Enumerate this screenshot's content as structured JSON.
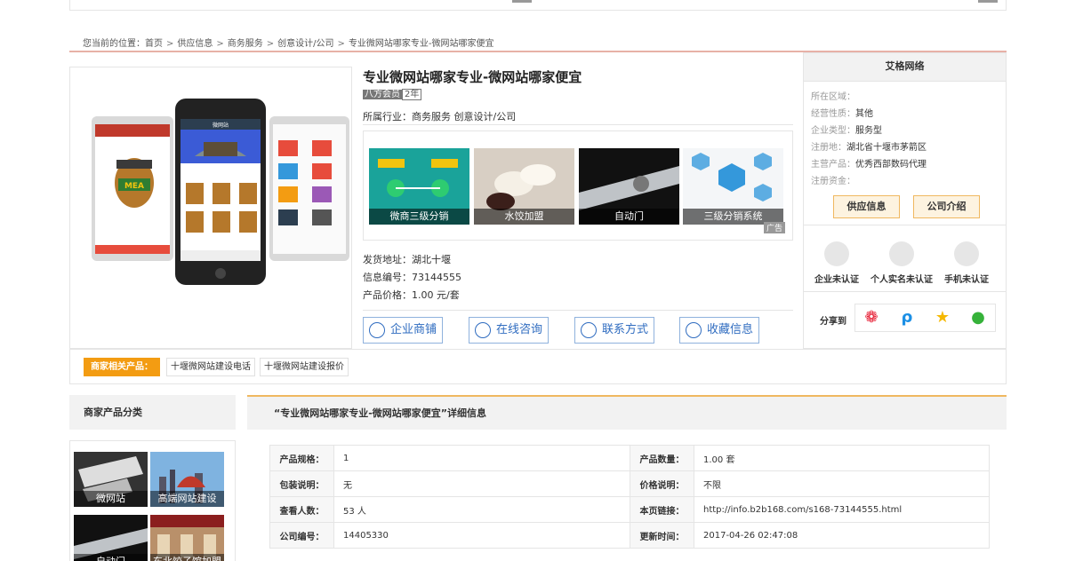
{
  "breadcrumb": {
    "prefix": "您当前的位置：",
    "items": [
      "首页",
      "供应信息",
      "商务服务",
      "创意设计/公司",
      "专业微网站哪家专业-微网站哪家便宜"
    ]
  },
  "product": {
    "title": "专业微网站哪家专业-微网站哪家便宜",
    "member_label": "八方会员",
    "member_years": "2年",
    "industry": "所属行业：商务服务 创意设计/公司",
    "ads": [
      "微商三级分销",
      "水饺加盟",
      "自动门",
      "三级分销系统"
    ],
    "ad_tag": "广告",
    "ship_from": "发货地址：湖北十堰",
    "info_id": "信息编号：73144555",
    "price": "产品价格：1.00 元/套",
    "actions": [
      "企业商铺",
      "在线咨询",
      "联系方式",
      "收藏信息"
    ],
    "phone_mock": {
      "jar_label": "MEA",
      "center_header": "微网站"
    }
  },
  "seller": {
    "name": "艾格网络",
    "rows": [
      {
        "label": "所在区域：",
        "value": ""
      },
      {
        "label": "经营性质：",
        "value": "其他"
      },
      {
        "label": "企业类型：",
        "value": "服务型"
      },
      {
        "label": "注册地：",
        "value": "湖北省十堰市茅箭区"
      },
      {
        "label": "主营产品：",
        "value": "优秀西部数码代理"
      },
      {
        "label": "注册资金：",
        "value": ""
      }
    ],
    "buttons": [
      "供应信息",
      "公司介绍"
    ],
    "certs": [
      "企业未认证",
      "个人实名未认证",
      "手机未认证"
    ],
    "share_label": "分享到"
  },
  "related": {
    "label": "商家相关产品：",
    "tags": [
      "十堰微网站建设电话",
      "十堰微网站建设报价"
    ]
  },
  "categories": {
    "title": "商家产品分类",
    "items": [
      "微网站",
      "高端网站建设",
      "自动门",
      "东北饺子馆加盟"
    ]
  },
  "detail": {
    "title": "“专业微网站哪家专业-微网站哪家便宜”详细信息",
    "rows": [
      [
        {
          "k": "产品规格：",
          "v": "1"
        },
        {
          "k": "产品数量：",
          "v": "1.00 套"
        }
      ],
      [
        {
          "k": "包装说明：",
          "v": "无"
        },
        {
          "k": "价格说明：",
          "v": "不限"
        }
      ],
      [
        {
          "k": "查看人数：",
          "v": "53 人"
        },
        {
          "k": "本页链接：",
          "v": "http://info.b2b168.com/s168-73144555.html"
        }
      ],
      [
        {
          "k": "公司编号：",
          "v": "14405330"
        },
        {
          "k": "更新时间：",
          "v": "2017-04-26 02:47:08"
        }
      ]
    ]
  },
  "colors": {
    "accent_orange": "#f39c12",
    "link_blue": "#2f6cc0",
    "rule_red": "#e7b1a7"
  }
}
